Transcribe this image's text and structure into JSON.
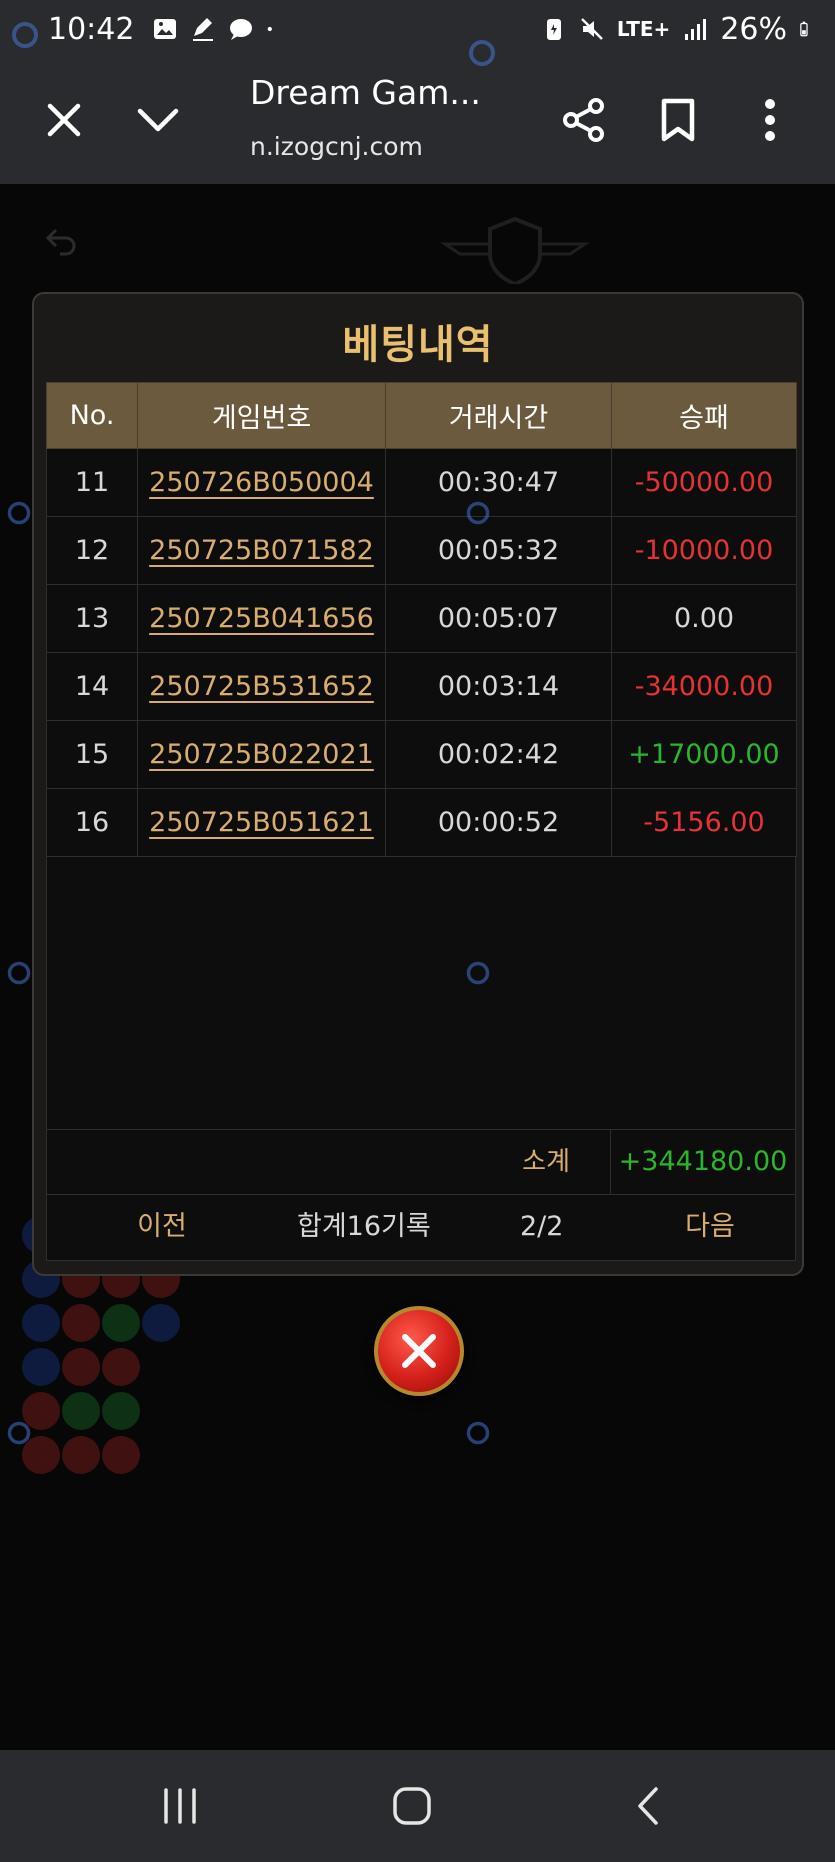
{
  "status_bar": {
    "time": "10:42",
    "network": "LTE+",
    "battery": "26%"
  },
  "browser": {
    "title": "Dream Gam...",
    "url": "n.izogcnj.com"
  },
  "modal": {
    "title": "베팅내역",
    "columns": [
      "No.",
      "게임번호",
      "거래시간",
      "승패"
    ],
    "rows": [
      {
        "no": "11",
        "game": "250726B050004",
        "time": "00:30:47",
        "result": "-50000.00"
      },
      {
        "no": "12",
        "game": "250725B071582",
        "time": "00:05:32",
        "result": "-10000.00"
      },
      {
        "no": "13",
        "game": "250725B041656",
        "time": "00:05:07",
        "result": "0.00"
      },
      {
        "no": "14",
        "game": "250725B531652",
        "time": "00:03:14",
        "result": "-34000.00"
      },
      {
        "no": "15",
        "game": "250725B022021",
        "time": "00:02:42",
        "result": "+17000.00"
      },
      {
        "no": "16",
        "game": "250725B051621",
        "time": "00:00:52",
        "result": "-5156.00"
      }
    ],
    "subtotal_label": "소계",
    "subtotal_value": "+344180.00",
    "pager": {
      "prev": "이전",
      "total": "합계16기록",
      "page": "2/2",
      "next": "다음"
    }
  },
  "colors": {
    "header_bg": "#6b5a3e",
    "title_gold": "#e8c06e",
    "negative": "#e53232",
    "positive": "#2bb52b"
  }
}
